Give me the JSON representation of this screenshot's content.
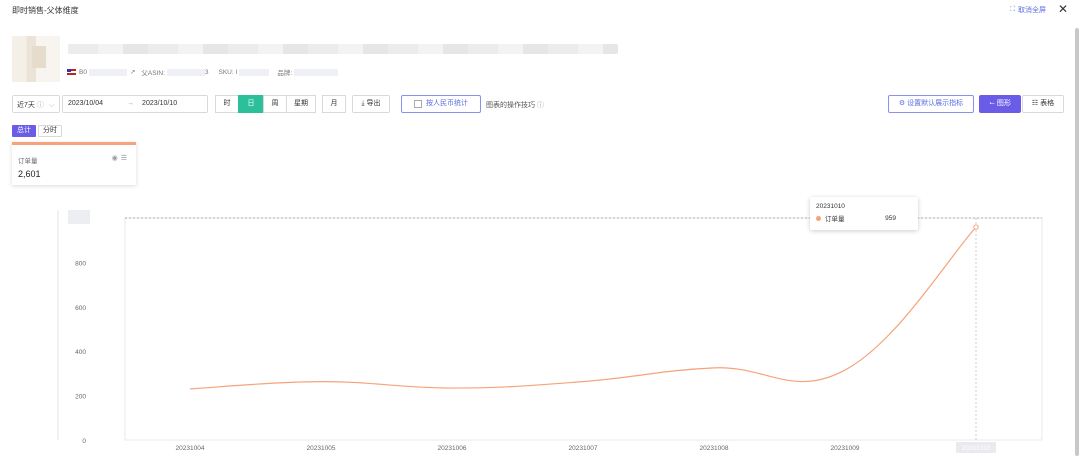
{
  "header": {
    "title": "即时销售-父体维度",
    "exit_fullscreen": "取消全屏",
    "exit_icon": "⛶",
    "close_icon": "✕"
  },
  "product": {
    "asin_prefix": "B0",
    "parent_asin_label": "父ASIN:",
    "parent_asin_suffix": "3",
    "sku_label": "SKU: I",
    "brand_label": "品牌:"
  },
  "toolbar": {
    "range_select": "近7天",
    "date_start": "2023/10/04",
    "date_sep": "→",
    "date_end": "2023/10/10",
    "granularity": [
      "时",
      "日",
      "周",
      "星期",
      "月"
    ],
    "granularity_active": 1,
    "export_label": "导出",
    "rmb_label": "按人民币统计",
    "tips_label": "图表的操作技巧",
    "set_default_label": "设置默认展示指标",
    "chart_view_label": "图形",
    "table_view_label": "表格"
  },
  "view_tabs": [
    "总计",
    "分时"
  ],
  "metric_card": {
    "label": "订单量",
    "value": "2,601",
    "accent": "#f5a37a"
  },
  "tooltip": {
    "date": "20231010",
    "series": "订单量",
    "value": "959"
  },
  "colors": {
    "primary": "#6b5ce7",
    "active_tab": "#2bbf9a",
    "series": "#f5a37a"
  },
  "chart_data": {
    "type": "line",
    "x": [
      "20231004",
      "20231005",
      "20231006",
      "20231007",
      "20231008",
      "20231009",
      "20231010"
    ],
    "series": [
      {
        "name": "订单量",
        "values": [
          230,
          263,
          234,
          263,
          325,
          315,
          959
        ]
      }
    ],
    "yticks": [
      "0",
      "200",
      "400",
      "600",
      "800"
    ],
    "ylim": [
      0,
      1000
    ],
    "grid": false
  }
}
